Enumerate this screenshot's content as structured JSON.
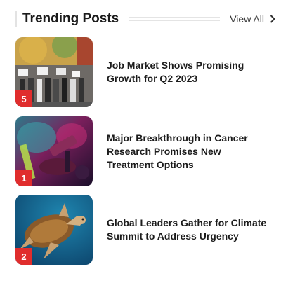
{
  "section": {
    "title": "Trending Posts",
    "view_all_label": "View All"
  },
  "posts": [
    {
      "rank": "5",
      "title": "Job Market Shows Promising Growth for Q2 2023",
      "image": "protest-crowd-photo"
    },
    {
      "rank": "1",
      "title": "Major Breakthrough in Cancer Research Promises New Treatment Options",
      "image": "lab-microscope-photo"
    },
    {
      "rank": "2",
      "title": "Global Leaders Gather for Climate Summit to Address Urgency",
      "image": "sea-turtle-photo"
    }
  ],
  "colors": {
    "rank_badge": "#e02d2d",
    "title_text": "#1c1c1c"
  }
}
